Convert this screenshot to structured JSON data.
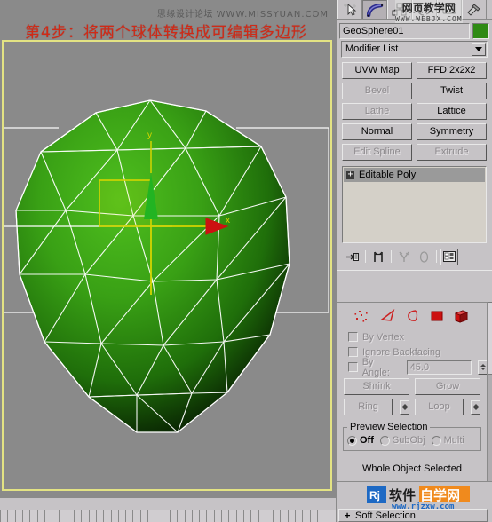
{
  "watermarks": {
    "viewport_cn": "思缘设计论坛",
    "viewport_url": "WWW.MISSYUAN.COM",
    "panel_cn": "网页教学网",
    "panel_url": "WWW.WEBJX.COM",
    "logo_cn": "软件自学网",
    "logo_url": "www.rjzxw.com",
    "logo_mark": "Rj"
  },
  "headline": "第4步：将两个球体转换成可编辑多边形",
  "viewport": {
    "axis_labels": {
      "x": "x",
      "y": "y"
    },
    "object_color": "#2f8a14",
    "wire_color": "#ffffff",
    "gizmo_x_color": "#d5d500",
    "gizmo_y_color": "#22b422",
    "gizmo_arrow_color": "#cc1111",
    "background": "#8a8a8a",
    "active_border_color": "#e3e383"
  },
  "command_panel": {
    "tabs": [
      {
        "name": "create",
        "icon": "create-star-icon",
        "selected": false
      },
      {
        "name": "modify",
        "icon": "modify-curve-icon",
        "selected": true
      },
      {
        "name": "hierarchy",
        "icon": "hierarchy-icon",
        "selected": false
      },
      {
        "name": "motion",
        "icon": "motion-wheel-icon",
        "selected": false
      },
      {
        "name": "display",
        "icon": "display-monitor-icon",
        "selected": false
      },
      {
        "name": "utilities",
        "icon": "utilities-hammer-icon",
        "selected": false
      }
    ],
    "object_name": "GeoSphere01",
    "object_color": "#2f8a14",
    "modifier_list_label": "Modifier List",
    "modifier_buttons": [
      {
        "label": "UVW Map",
        "enabled": true
      },
      {
        "label": "FFD 2x2x2",
        "enabled": true
      },
      {
        "label": "Bevel",
        "enabled": false
      },
      {
        "label": "Twist",
        "enabled": true
      },
      {
        "label": "Lathe",
        "enabled": false
      },
      {
        "label": "Lattice",
        "enabled": true
      },
      {
        "label": "Normal",
        "enabled": true
      },
      {
        "label": "Symmetry",
        "enabled": true
      },
      {
        "label": "Edit Spline",
        "enabled": false
      },
      {
        "label": "Extrude",
        "enabled": false
      }
    ],
    "stack": [
      {
        "label": "Editable Poly",
        "selected": true,
        "expandable": "+"
      }
    ],
    "stack_tools": [
      {
        "name": "pin-stack-icon"
      },
      {
        "name": "show-end-result-icon"
      },
      {
        "name": "make-unique-icon"
      },
      {
        "name": "remove-modifier-icon"
      },
      {
        "name": "configure-modifier-sets-icon"
      }
    ],
    "selection": {
      "sub_object_icons": [
        {
          "name": "vertex-icon"
        },
        {
          "name": "edge-icon"
        },
        {
          "name": "border-icon"
        },
        {
          "name": "polygon-icon"
        },
        {
          "name": "element-icon"
        }
      ],
      "checkboxes": [
        {
          "label": "By Vertex",
          "checked": false,
          "enabled": false
        },
        {
          "label": "Ignore Backfacing",
          "checked": false,
          "enabled": false
        },
        {
          "label": "By Angle:",
          "checked": false,
          "enabled": false
        }
      ],
      "by_angle_value": "45.0",
      "buttons": [
        {
          "label": "Shrink",
          "enabled": false
        },
        {
          "label": "Grow",
          "enabled": false
        },
        {
          "label": "Ring",
          "enabled": false
        },
        {
          "label": "Loop",
          "enabled": false
        }
      ],
      "preview_group_label": "Preview Selection",
      "preview_options": [
        {
          "label": "Off",
          "selected": true,
          "enabled": true
        },
        {
          "label": "SubObj",
          "selected": false,
          "enabled": false
        },
        {
          "label": "Multi",
          "selected": false,
          "enabled": false
        }
      ],
      "status": "Whole Object Selected"
    },
    "next_rollout": {
      "label": "Soft Selection",
      "toggle": "+"
    }
  }
}
